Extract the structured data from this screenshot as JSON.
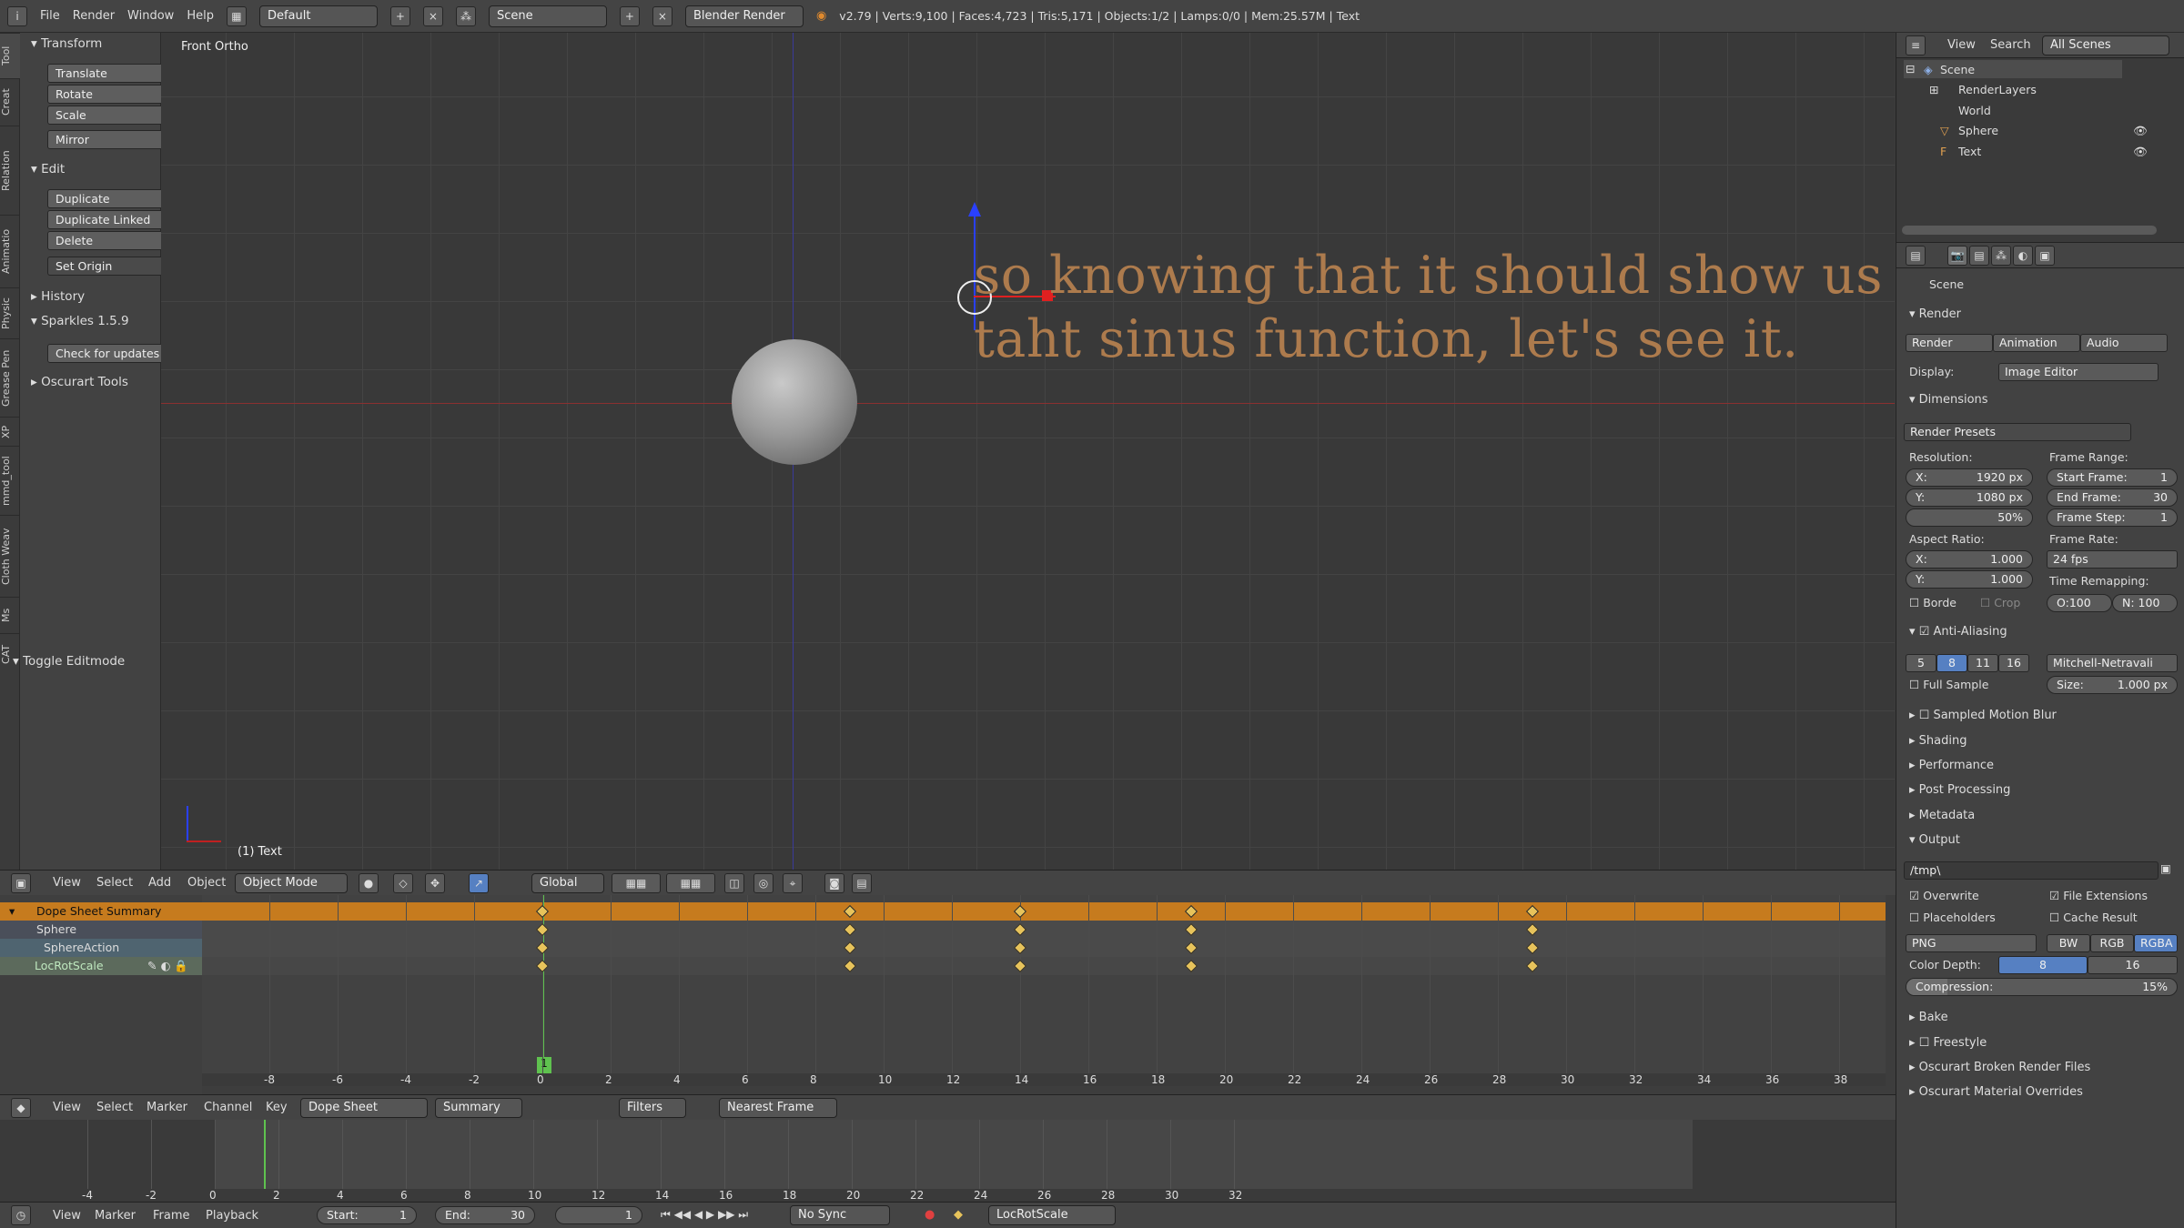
{
  "topbar": {
    "menus": [
      "File",
      "Render",
      "Window",
      "Help"
    ],
    "layout": "Default",
    "scene": "Scene",
    "engine": "Blender Render",
    "stats": "v2.79 | Verts:9,100 | Faces:4,723 | Tris:5,171 | Objects:1/2 | Lamps:0/0 | Mem:25.57M | Text"
  },
  "toolshelf": {
    "tabs": [
      "Tool",
      "Creat",
      "Relation",
      "Animatio",
      "Physic",
      "Grease Pen",
      "XP",
      "mmd_tool",
      "Cloth Weav",
      "Ms",
      "CAT"
    ],
    "transform": {
      "title": "Transform",
      "buttons": [
        "Translate",
        "Rotate",
        "Scale",
        "Mirror"
      ]
    },
    "edit": {
      "title": "Edit",
      "buttons": [
        "Duplicate",
        "Duplicate Linked",
        "Delete"
      ],
      "set_origin": "Set Origin"
    },
    "history": "History",
    "sparkles": "Sparkles 1.5.9",
    "check_updates": "Check for updates",
    "oscurart": "Oscurart Tools",
    "toggle_editmode": "Toggle Editmode"
  },
  "viewport": {
    "view_name": "Front Ortho",
    "object_label": "(1) Text",
    "text_line1": "so knowing that it should show us",
    "text_line2": "taht sinus function, let's see it."
  },
  "viewport_header": {
    "menus": [
      "View",
      "Select",
      "Add",
      "Object"
    ],
    "mode": "Object Mode",
    "orientation": "Global"
  },
  "outliner": {
    "menus": [
      "View",
      "Search"
    ],
    "filter": "All Scenes",
    "items": [
      "Scene",
      "RenderLayers",
      "World",
      "Sphere",
      "Text"
    ]
  },
  "properties": {
    "context": "Scene",
    "render": {
      "title": "Render",
      "buttons": [
        "Render",
        "Animation",
        "Audio"
      ],
      "display_label": "Display:",
      "display_value": "Image Editor"
    },
    "dimensions": {
      "title": "Dimensions",
      "presets": "Render Presets",
      "resolution_label": "Resolution:",
      "res_x": "X:",
      "res_x_val": "1920 px",
      "res_y": "Y:",
      "res_y_val": "1080 px",
      "res_pct": "50%",
      "frame_range_label": "Frame Range:",
      "start": "Start Frame:",
      "start_val": "1",
      "end": "End Frame:",
      "end_val": "30",
      "step": "Frame Step:",
      "step_val": "1",
      "aspect_label": "Aspect Ratio:",
      "asp_x": "X:",
      "asp_x_val": "1.000",
      "asp_y": "Y:",
      "asp_y_val": "1.000",
      "frame_rate_label": "Frame Rate:",
      "fps": "24 fps",
      "remap_label": "Time Remapping:",
      "old": "O:100",
      "new": "N: 100",
      "border": "Borde",
      "crop": "Crop"
    },
    "aa": {
      "title": "Anti-Aliasing",
      "samples": [
        "5",
        "8",
        "11",
        "16"
      ],
      "filter": "Mitchell-Netravali",
      "full_sample": "Full Sample",
      "size": "Size:",
      "size_val": "1.000 px"
    },
    "collapsed": [
      "Sampled Motion Blur",
      "Shading",
      "Performance",
      "Post Processing",
      "Metadata"
    ],
    "output": {
      "title": "Output",
      "path": "/tmp\\",
      "overwrite": "Overwrite",
      "file_ext": "File Extensions",
      "placeholders": "Placeholders",
      "cache": "Cache Result",
      "format": "PNG",
      "bw": "BW",
      "rgb": "RGB",
      "rgba": "RGBA",
      "depth_label": "Color Depth:",
      "d8": "8",
      "d16": "16",
      "compression": "Compression:",
      "comp_val": "15%",
      "comp_frac": 0.15
    },
    "bottom": [
      "Bake",
      "Freestyle",
      "Oscurart Broken Render Files",
      "Oscurart Material Overrides"
    ]
  },
  "dopesheet": {
    "channels": [
      "Dope Sheet Summary",
      "Sphere",
      "SphereAction",
      "LocRotScale"
    ],
    "keyframes": [
      1,
      10,
      15,
      20,
      30
    ],
    "current_frame": "1",
    "ruler": [
      "-8",
      "-6",
      "-4",
      "-2",
      "0",
      "2",
      "4",
      "6",
      "8",
      "10",
      "12",
      "14",
      "16",
      "18",
      "20",
      "22",
      "24",
      "26",
      "28",
      "30",
      "32",
      "34",
      "36",
      "38"
    ],
    "footer_menus": [
      "View",
      "Select",
      "Marker",
      "Channel",
      "Key"
    ],
    "mode": "Dope Sheet",
    "summary": "Summary",
    "filters": "Filters",
    "snap": "Nearest Frame"
  },
  "timeline": {
    "ruler": [
      "-4",
      "-2",
      "0",
      "2",
      "4",
      "6",
      "8",
      "10",
      "12",
      "14",
      "16",
      "18",
      "20",
      "22",
      "24",
      "26",
      "28",
      "30",
      "32"
    ],
    "menus": [
      "View",
      "Marker",
      "Frame",
      "Playback"
    ],
    "start": "Start:",
    "start_val": "1",
    "end": "End:",
    "end_val": "30",
    "current": "1",
    "sync": "No Sync",
    "keying": "LocRotScale"
  },
  "colors": {
    "accent": "#5680c2",
    "summary_bar": "#c67b1e",
    "playhead": "#5fc24f",
    "keyframe": "#e7c35b",
    "text_object": "#ad7b4d"
  }
}
